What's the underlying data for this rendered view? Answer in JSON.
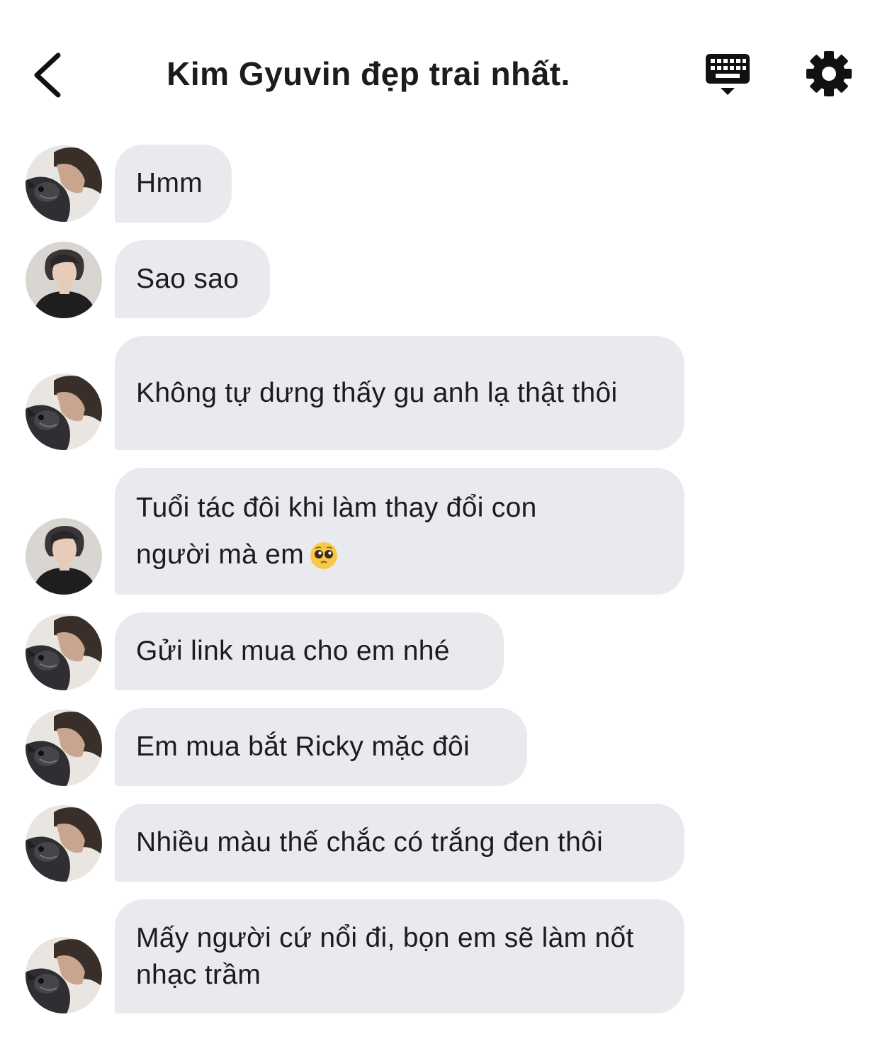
{
  "header": {
    "title": "Kim Gyuvin đẹp trai nhất."
  },
  "icons": {
    "back": "chevron-left-icon",
    "keyboard": "keyboard-icon",
    "settings": "gear-icon"
  },
  "colors": {
    "bubble": "#e8eaee",
    "text": "#1c1c1e",
    "background": "#ffffff"
  },
  "messages": [
    {
      "avatar": "avatar-a",
      "text": "Hmm"
    },
    {
      "avatar": "avatar-b",
      "text": "Sao sao"
    },
    {
      "avatar": "avatar-a",
      "text": "Không tự dưng thấy gu anh lạ thật thôi"
    },
    {
      "avatar": "avatar-b",
      "text": "Tuổi tác đôi khi làm thay đổi con người mà em",
      "emoji": "pleading-face"
    },
    {
      "avatar": "avatar-a",
      "text": "Gửi link mua cho em nhé"
    },
    {
      "avatar": "avatar-a",
      "text": "Em mua bắt Ricky mặc đôi"
    },
    {
      "avatar": "avatar-a",
      "text": "Nhiều màu thế chắc có trắng đen thôi"
    },
    {
      "avatar": "avatar-a",
      "text": "Mấy người cứ nổi đi, bọn em sẽ làm nốt nhạc trầm"
    }
  ]
}
